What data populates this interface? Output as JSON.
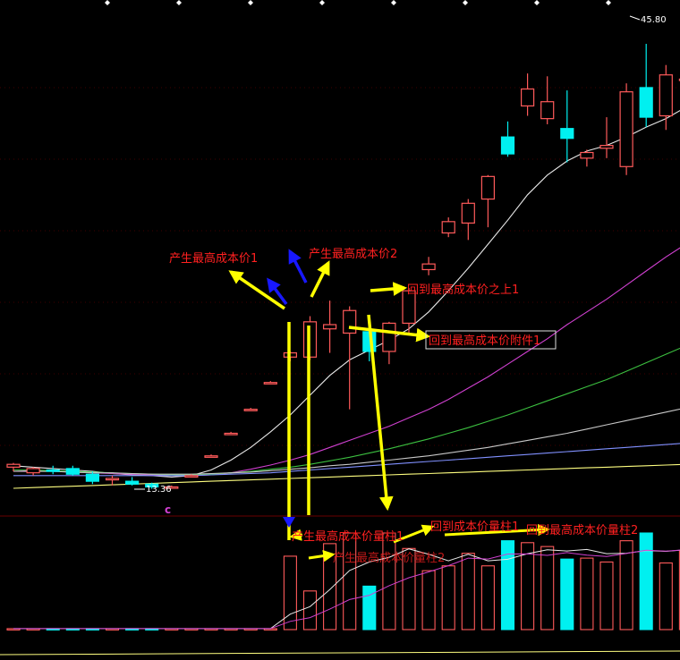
{
  "colors": {
    "background": "#000000",
    "grid": "#6a0000",
    "candle_up": "#ff5a5a",
    "candle_down": "#00f0f0",
    "ma_white": "#e8e8e8",
    "ma_yellow": "#ffff80",
    "ma_magenta": "#d040d0",
    "ma_green": "#3cc040",
    "ma_gray": "#c8c8c8",
    "ma_blue": "#8090ff",
    "annotation_red": "#ff2020",
    "arrow_yellow": "#ffff00",
    "arrow_blue": "#1818ff",
    "volume_up": "#ff5a5a",
    "volume_down": "#00f0f0"
  },
  "price_panel": {
    "high_label": "45.80",
    "low_label": "13.36",
    "marker": "c",
    "annotations": [
      {
        "text": "产生最高成本价1",
        "style": "plain"
      },
      {
        "text": "产生最高成本价2",
        "style": "plain"
      },
      {
        "text": "回到最高成本价之上1",
        "style": "plain"
      },
      {
        "text": "回到最高成本价附件1",
        "style": "boxed"
      }
    ]
  },
  "volume_panel": {
    "annotations": [
      {
        "text": "产生最高成本价量柱1"
      },
      {
        "text": "产生最高成本价量柱2"
      },
      {
        "text": "回到成本价量柱1"
      },
      {
        "text": "回到最高成本价量柱2"
      }
    ]
  },
  "chart_data": {
    "type": "candlestick",
    "title": "",
    "y_price_range": [
      11.5,
      47.5
    ],
    "candles": [
      {
        "o": 14.9,
        "h": 15.2,
        "l": 14.6,
        "c": 15.1
      },
      {
        "o": 14.5,
        "h": 14.9,
        "l": 14.3,
        "c": 14.8
      },
      {
        "o": 14.7,
        "h": 15.0,
        "l": 14.4,
        "c": 14.6
      },
      {
        "o": 14.8,
        "h": 15.0,
        "l": 14.3,
        "c": 14.4
      },
      {
        "o": 14.4,
        "h": 14.6,
        "l": 13.7,
        "c": 13.9
      },
      {
        "o": 14.0,
        "h": 14.3,
        "l": 13.6,
        "c": 14.1
      },
      {
        "o": 13.9,
        "h": 14.2,
        "l": 13.6,
        "c": 13.7
      },
      {
        "o": 13.7,
        "h": 13.8,
        "l": 13.36,
        "c": 13.5
      },
      {
        "o": 13.5,
        "h": 13.6,
        "l": 13.4,
        "c": 13.5
      },
      {
        "o": 14.3,
        "h": 14.4,
        "l": 14.2,
        "c": 14.3
      },
      {
        "o": 15.7,
        "h": 15.8,
        "l": 15.6,
        "c": 15.7
      },
      {
        "o": 17.3,
        "h": 17.4,
        "l": 17.2,
        "c": 17.3
      },
      {
        "o": 19.0,
        "h": 19.1,
        "l": 18.9,
        "c": 19.0
      },
      {
        "o": 20.9,
        "h": 21.0,
        "l": 20.8,
        "c": 20.9
      },
      {
        "o": 22.7,
        "h": 23.1,
        "l": 22.4,
        "c": 23.0
      },
      {
        "o": 22.7,
        "h": 25.6,
        "l": 22.5,
        "c": 25.2
      },
      {
        "o": 24.7,
        "h": 26.7,
        "l": 23.0,
        "c": 25.0
      },
      {
        "o": 24.4,
        "h": 26.3,
        "l": 19.0,
        "c": 26.0
      },
      {
        "o": 24.5,
        "h": 25.7,
        "l": 22.4,
        "c": 23.1
      },
      {
        "o": 23.1,
        "h": 25.2,
        "l": 22.2,
        "c": 25.1
      },
      {
        "o": 25.1,
        "h": 27.6,
        "l": 24.3,
        "c": 27.4
      },
      {
        "o": 28.9,
        "h": 29.8,
        "l": 28.5,
        "c": 29.3
      },
      {
        "o": 31.5,
        "h": 32.6,
        "l": 31.2,
        "c": 32.3
      },
      {
        "o": 32.2,
        "h": 33.9,
        "l": 31.0,
        "c": 33.6
      },
      {
        "o": 33.9,
        "h": 35.6,
        "l": 31.9,
        "c": 35.5
      },
      {
        "o": 38.3,
        "h": 39.4,
        "l": 36.9,
        "c": 37.1
      },
      {
        "o": 40.5,
        "h": 42.8,
        "l": 39.8,
        "c": 41.7
      },
      {
        "o": 39.6,
        "h": 42.6,
        "l": 39.2,
        "c": 40.8
      },
      {
        "o": 38.9,
        "h": 41.6,
        "l": 36.5,
        "c": 38.2
      },
      {
        "o": 36.8,
        "h": 37.4,
        "l": 36.2,
        "c": 37.2
      },
      {
        "o": 37.5,
        "h": 39.7,
        "l": 36.8,
        "c": 37.7
      },
      {
        "o": 36.2,
        "h": 42.1,
        "l": 35.6,
        "c": 41.5
      },
      {
        "o": 41.8,
        "h": 44.9,
        "l": 39.0,
        "c": 39.7
      },
      {
        "o": 39.8,
        "h": 43.4,
        "l": 38.8,
        "c": 42.7
      },
      {
        "o": 42.4,
        "h": 43.0,
        "l": 42.0,
        "c": 42.4
      },
      {
        "o": 42.5,
        "h": 44.3,
        "l": 40.0,
        "c": 44.0
      },
      {
        "o": 43.2,
        "h": 45.8,
        "l": 40.2,
        "c": 42.1
      },
      {
        "o": 41.9,
        "h": 42.5,
        "l": 38.5,
        "c": 40.0
      }
    ],
    "moving_averages": [
      {
        "color_key": "ma_white",
        "values": [
          15.0,
          14.9,
          14.8,
          14.7,
          14.6,
          14.45,
          14.35,
          14.3,
          14.2,
          14.3,
          14.7,
          15.4,
          16.3,
          17.4,
          18.6,
          20.0,
          21.4,
          22.5,
          23.2,
          23.9,
          24.7,
          25.9,
          27.4,
          29.0,
          30.7,
          32.4,
          34.2,
          35.6,
          36.6,
          37.3,
          37.7,
          38.3,
          39.0,
          39.6,
          40.4,
          41.1,
          41.7,
          42.0
        ]
      },
      {
        "color_key": "ma_magenta",
        "values": [
          14.7,
          14.65,
          14.6,
          14.55,
          14.5,
          14.45,
          14.4,
          14.35,
          14.3,
          14.3,
          14.35,
          14.5,
          14.75,
          15.05,
          15.4,
          15.8,
          16.3,
          16.8,
          17.3,
          17.8,
          18.4,
          19.0,
          19.7,
          20.5,
          21.3,
          22.2,
          23.1,
          24.0,
          25.0,
          25.9,
          26.8,
          27.8,
          28.8,
          29.8,
          30.7,
          31.6,
          32.4,
          33.1
        ]
      },
      {
        "color_key": "ma_green",
        "values": [
          14.7,
          14.7,
          14.65,
          14.6,
          14.55,
          14.5,
          14.45,
          14.4,
          14.35,
          14.35,
          14.4,
          14.5,
          14.6,
          14.75,
          14.9,
          15.1,
          15.35,
          15.6,
          15.9,
          16.2,
          16.55,
          16.9,
          17.3,
          17.7,
          18.15,
          18.6,
          19.1,
          19.6,
          20.1,
          20.6,
          21.1,
          21.7,
          22.3,
          22.9,
          23.5,
          24.1,
          24.7,
          25.2
        ]
      },
      {
        "color_key": "ma_gray",
        "values": [
          14.6,
          14.6,
          14.6,
          14.55,
          14.5,
          14.5,
          14.45,
          14.4,
          14.4,
          14.4,
          14.45,
          14.5,
          14.55,
          14.65,
          14.75,
          14.85,
          15.0,
          15.1,
          15.25,
          15.4,
          15.55,
          15.7,
          15.9,
          16.1,
          16.3,
          16.55,
          16.8,
          17.05,
          17.3,
          17.6,
          17.9,
          18.2,
          18.5,
          18.8,
          19.1,
          19.4,
          19.8,
          20.1
        ]
      },
      {
        "color_key": "ma_blue",
        "values": [
          14.3,
          14.3,
          14.3,
          14.3,
          14.3,
          14.3,
          14.3,
          14.3,
          14.3,
          14.3,
          14.35,
          14.4,
          14.45,
          14.5,
          14.6,
          14.7,
          14.8,
          14.9,
          15.0,
          15.1,
          15.2,
          15.3,
          15.4,
          15.5,
          15.6,
          15.7,
          15.8,
          15.9,
          16.0,
          16.1,
          16.2,
          16.3,
          16.4,
          16.5,
          16.6,
          16.7,
          16.8,
          16.9
        ]
      },
      {
        "color_key": "ma_yellow",
        "values": [
          13.4,
          13.45,
          13.5,
          13.55,
          13.6,
          13.65,
          13.7,
          13.75,
          13.8,
          13.85,
          13.9,
          13.95,
          14.0,
          14.05,
          14.1,
          14.15,
          14.2,
          14.25,
          14.3,
          14.35,
          14.4,
          14.45,
          14.5,
          14.55,
          14.6,
          14.65,
          14.7,
          14.75,
          14.8,
          14.85,
          14.9,
          14.95,
          15.0,
          15.05,
          15.1,
          15.15,
          15.2,
          15.25
        ]
      }
    ],
    "volume": {
      "y_range": [
        0,
        100
      ],
      "values": [
        1,
        1,
        1,
        1,
        1,
        1,
        1,
        1,
        1,
        1,
        1,
        1,
        1,
        1,
        76,
        40,
        89,
        100,
        45,
        100,
        84,
        61,
        66,
        79,
        66,
        92,
        90,
        86,
        73,
        74,
        70,
        92,
        100,
        69,
        82,
        60,
        60,
        50
      ]
    }
  }
}
